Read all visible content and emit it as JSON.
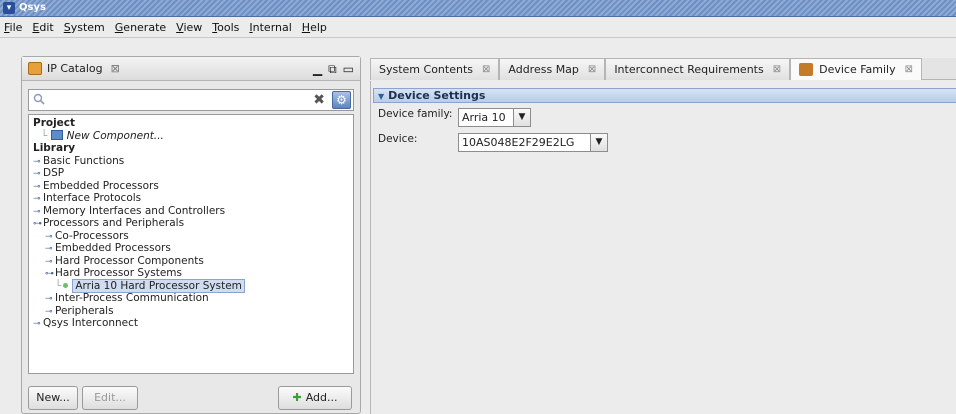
{
  "window": {
    "title": "Qsys"
  },
  "menu": [
    {
      "pre": "",
      "u": "F",
      "post": "ile"
    },
    {
      "pre": "",
      "u": "E",
      "post": "dit"
    },
    {
      "pre": "",
      "u": "S",
      "post": "ystem"
    },
    {
      "pre": "",
      "u": "G",
      "post": "enerate"
    },
    {
      "pre": "",
      "u": "V",
      "post": "iew"
    },
    {
      "pre": "",
      "u": "T",
      "post": "ools"
    },
    {
      "pre": "",
      "u": "I",
      "post": "nternal"
    },
    {
      "pre": "",
      "u": "H",
      "post": "elp"
    }
  ],
  "ip_catalog": {
    "title": "IP Catalog",
    "close_glyph": "⊠",
    "search": {
      "value": "",
      "placeholder": ""
    },
    "tree": {
      "project": "Project",
      "new_component": "New Component...",
      "library": "Library",
      "basic_functions": "Basic Functions",
      "dsp": "DSP",
      "embedded_processors": "Embedded Processors",
      "interface_protocols": "Interface Protocols",
      "memory_interfaces": "Memory Interfaces and Controllers",
      "processors_peripherals": "Processors and Peripherals",
      "co_processors": "Co-Processors",
      "embedded_processors_sub": "Embedded Processors",
      "hard_processor_components": "Hard Processor Components",
      "hard_processor_systems": "Hard Processor Systems",
      "arria10_hps": "Arria 10 Hard Processor System",
      "inter_process": "Inter-Process Communication",
      "peripherals": "Peripherals",
      "qsys_interconnect": "Qsys Interconnect"
    },
    "buttons": {
      "new": "New...",
      "edit": "Edit...",
      "add": "Add..."
    }
  },
  "tabs": [
    {
      "label": "System Contents"
    },
    {
      "label": "Address Map"
    },
    {
      "label": "Interconnect Requirements"
    },
    {
      "label": "Device Family"
    }
  ],
  "device_settings": {
    "header": "Device Settings",
    "family_label": "Device family:",
    "family_value": "Arria 10",
    "device_label": "Device:",
    "device_value": "10AS048E2F29E2LG"
  },
  "icons": [
    "chevron-down-icon",
    "catalog-icon",
    "search-icon",
    "clear-icon",
    "gear-icon",
    "component-icon",
    "device-family-icon"
  ]
}
